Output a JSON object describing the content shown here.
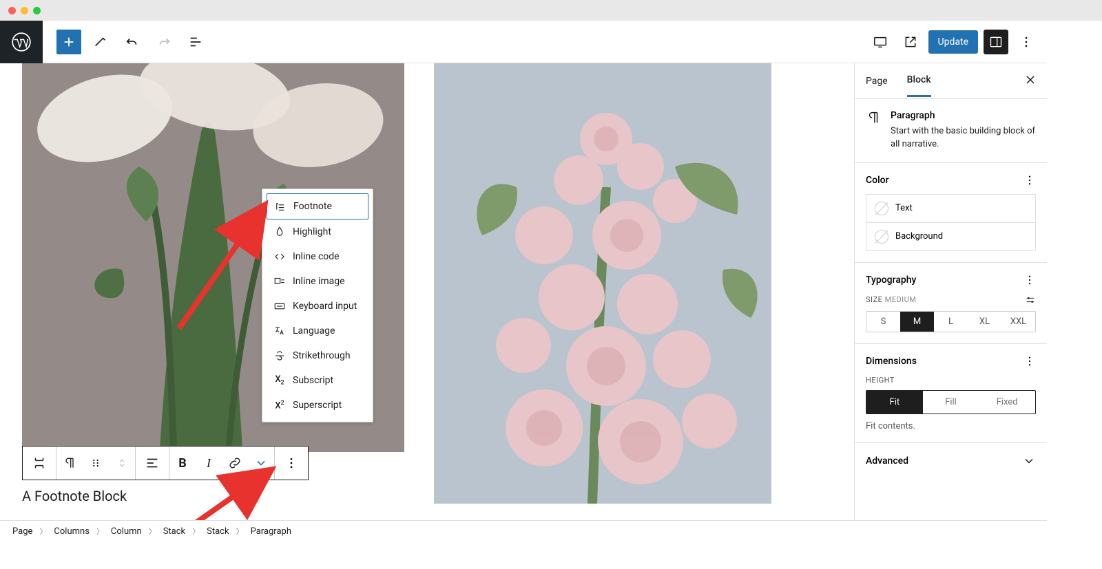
{
  "header": {
    "update_label": "Update"
  },
  "caption": "A Footnote Block",
  "dropdown": {
    "items": [
      {
        "label": "Footnote"
      },
      {
        "label": "Highlight"
      },
      {
        "label": "Inline code"
      },
      {
        "label": "Inline image"
      },
      {
        "label": "Keyboard input"
      },
      {
        "label": "Language"
      },
      {
        "label": "Strikethrough"
      },
      {
        "label": "Subscript"
      },
      {
        "label": "Superscript"
      }
    ]
  },
  "sidebar": {
    "tabs": {
      "page": "Page",
      "block": "Block"
    },
    "block": {
      "title": "Paragraph",
      "description": "Start with the basic building block of all narrative."
    },
    "color": {
      "heading": "Color",
      "text": "Text",
      "background": "Background"
    },
    "typography": {
      "heading": "Typography",
      "size_label": "SIZE",
      "size_value": "MEDIUM",
      "options": [
        "S",
        "M",
        "L",
        "XL",
        "XXL"
      ],
      "active": "M"
    },
    "dimensions": {
      "heading": "Dimensions",
      "height_label": "HEIGHT",
      "options": [
        "Fit",
        "Fill",
        "Fixed"
      ],
      "active": "Fit",
      "caption": "Fit contents."
    },
    "advanced": "Advanced"
  },
  "breadcrumb": [
    "Page",
    "Columns",
    "Column",
    "Stack",
    "Stack",
    "Paragraph"
  ]
}
